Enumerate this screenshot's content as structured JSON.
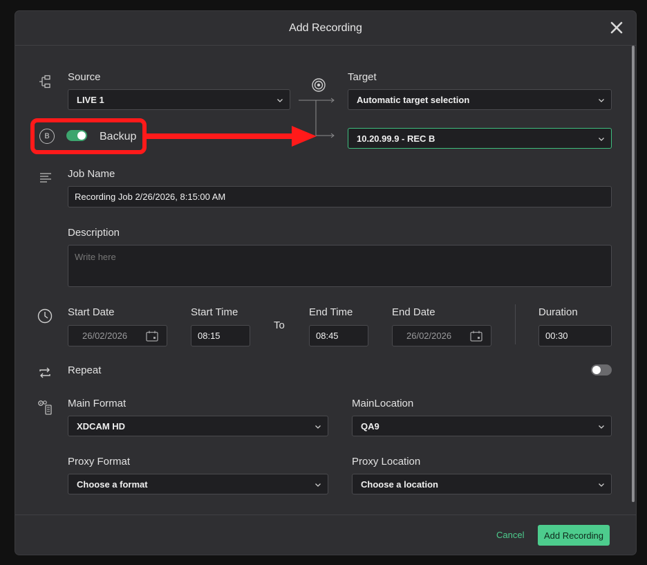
{
  "dialog": {
    "title": "Add Recording"
  },
  "source": {
    "label": "Source",
    "value": "LIVE 1"
  },
  "target": {
    "label": "Target",
    "value": "Automatic target selection",
    "backup_value": "10.20.99.9 - REC B"
  },
  "backup": {
    "badge": "B",
    "label": "Backup",
    "enabled": true
  },
  "job": {
    "label": "Job Name",
    "value": "Recording Job 2/26/2026, 8:15:00 AM"
  },
  "description": {
    "label": "Description",
    "placeholder": "Write here"
  },
  "schedule": {
    "start_date_label": "Start Date",
    "start_date": "26/02/2026",
    "start_time_label": "Start Time",
    "start_time": "08:15",
    "to_label": "To",
    "end_time_label": "End Time",
    "end_time": "08:45",
    "end_date_label": "End Date",
    "end_date": "26/02/2026",
    "duration_label": "Duration",
    "duration": "00:30"
  },
  "repeat": {
    "label": "Repeat",
    "enabled": false
  },
  "formats": {
    "main_format_label": "Main Format",
    "main_format": "XDCAM HD",
    "main_location_label": "MainLocation",
    "main_location": "QA9",
    "proxy_format_label": "Proxy Format",
    "proxy_format": "Choose a format",
    "proxy_location_label": "Proxy Location",
    "proxy_location": "Choose a location"
  },
  "footer": {
    "cancel_label": "Cancel",
    "submit_label": "Add Recording"
  },
  "colors": {
    "accent": "#4dcc8d",
    "annotation": "#ff1a1a",
    "panel": "#2f2f32",
    "field": "#1f1f22"
  }
}
